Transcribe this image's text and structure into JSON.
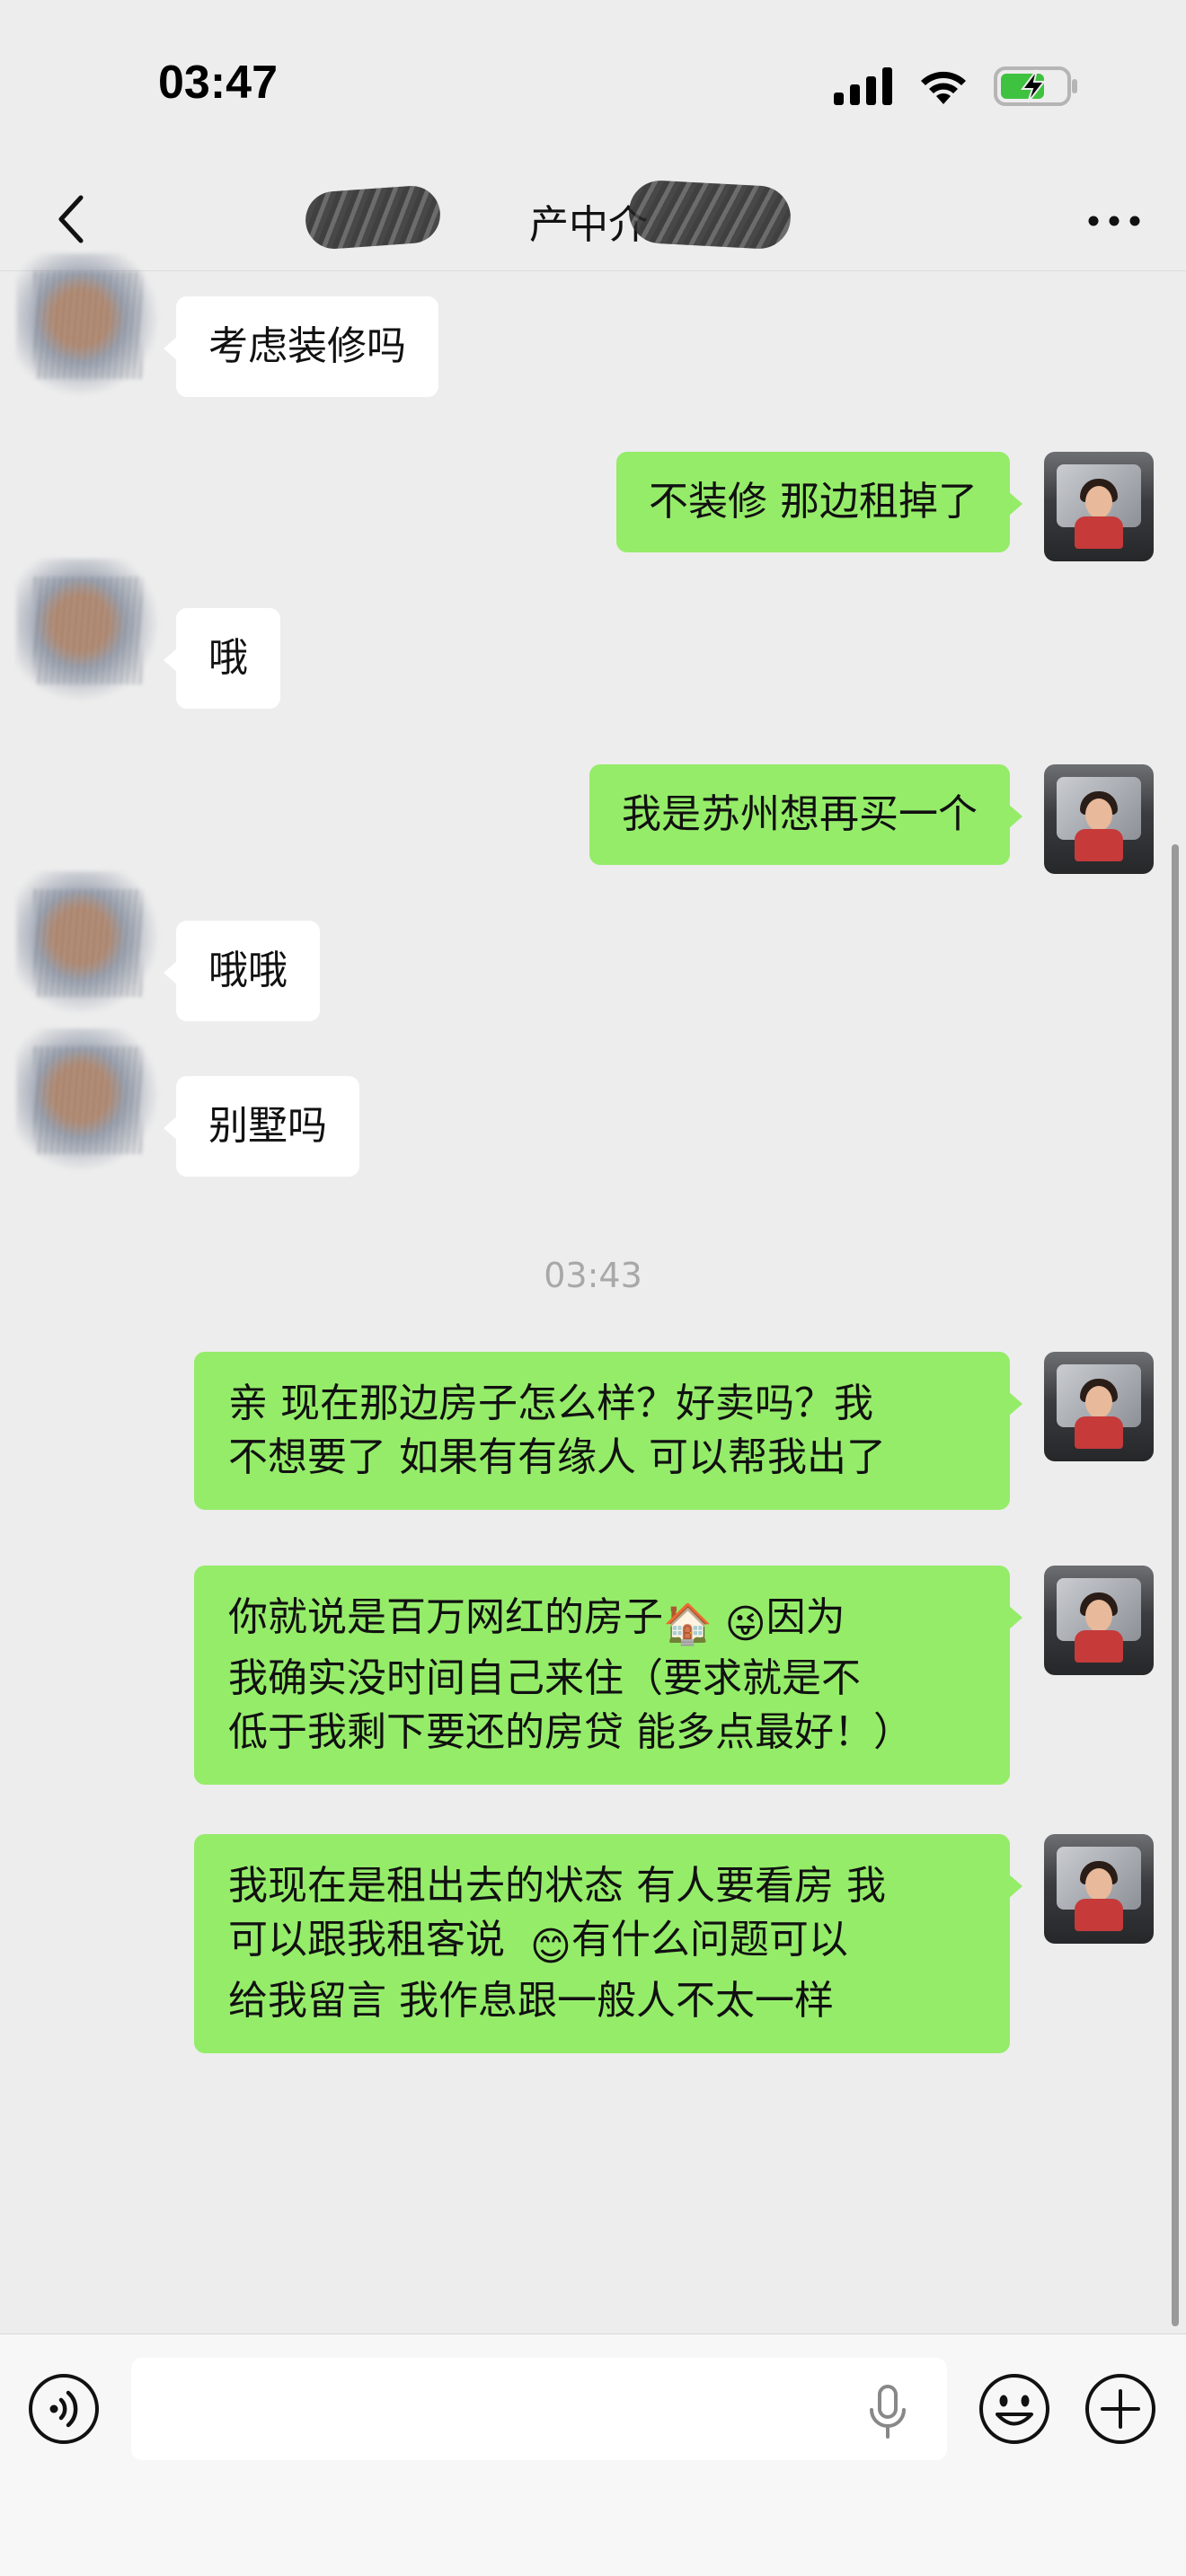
{
  "status_bar": {
    "time": "03:47"
  },
  "header": {
    "title": "产中介",
    "back_icon": "chevron-left-icon",
    "more_icon": "more-dots-icon"
  },
  "messages": [
    {
      "side": "in",
      "text": "考虑装修吗"
    },
    {
      "side": "out",
      "text": "不装修 那边租掉了"
    },
    {
      "side": "in",
      "text": "哦"
    },
    {
      "side": "out",
      "text": "我是苏州想再买一个"
    },
    {
      "side": "in",
      "text": "哦哦"
    },
    {
      "side": "in",
      "text": "别墅吗"
    },
    {
      "side": "out",
      "lines": [
        "亲 现在那边房子怎么样？好卖吗？我",
        "不想要了 如果有有缘人 可以帮我出了"
      ]
    },
    {
      "side": "out",
      "lines": [
        "你就说是百万网红的房子",
        "因为",
        "我确实没时间自己来住（要求就是不",
        "低于我剩下要还的房贷  能多点最好！）"
      ],
      "emojis": [
        "🏠",
        "😜"
      ]
    },
    {
      "side": "out",
      "lines": [
        "我现在是租出去的状态 有人要看房 我",
        "可以跟我租客说",
        "有什么问题可以",
        "给我留言 我作息跟一般人不太一样"
      ],
      "emojis": [
        "😊"
      ]
    }
  ],
  "timestamp": "03:43",
  "input_bar": {
    "placeholder": "",
    "voice_icon": "voice-icon",
    "mic_icon": "mic-icon",
    "emoji_icon": "emoji-icon",
    "plus_icon": "plus-icon"
  },
  "colors": {
    "background": "#ededed",
    "outgoing_bubble": "#95ec69",
    "incoming_bubble": "#ffffff"
  }
}
